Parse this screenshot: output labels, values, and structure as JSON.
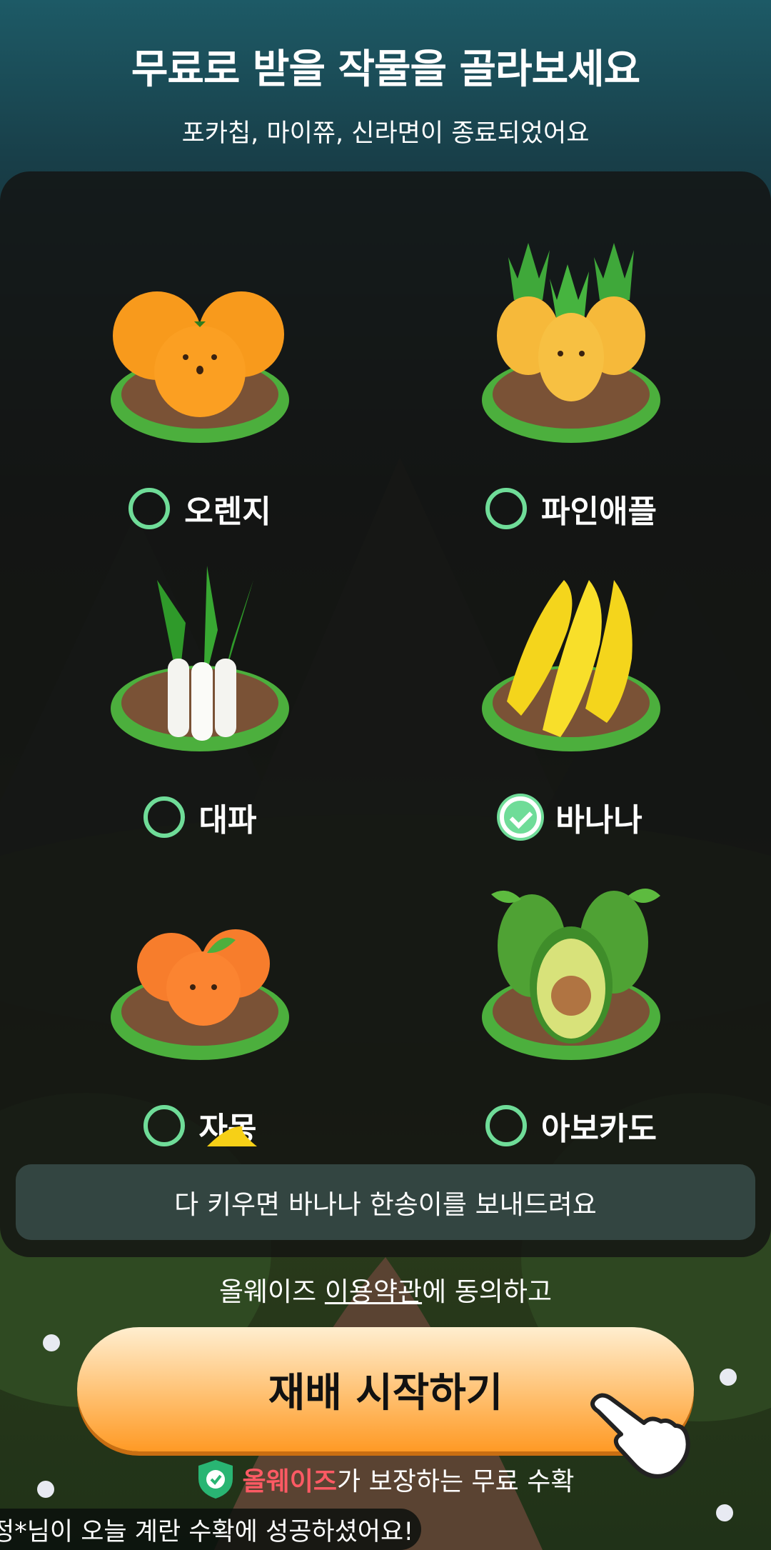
{
  "header": {
    "title": "무료로 받을 작물을 골라보세요",
    "subtitle": "포카칩, 마이쮸, 신라면이 종료되었어요"
  },
  "crops": [
    {
      "name": "오렌지",
      "icon": "orange-icon",
      "selected": false
    },
    {
      "name": "파인애플",
      "icon": "pineapple-icon",
      "selected": false
    },
    {
      "name": "대파",
      "icon": "green-onion-icon",
      "selected": false
    },
    {
      "name": "바나나",
      "icon": "banana-icon",
      "selected": true
    },
    {
      "name": "자몽",
      "icon": "grapefruit-icon",
      "selected": false
    },
    {
      "name": "아보카도",
      "icon": "avocado-icon",
      "selected": false
    }
  ],
  "notice": "다 키우면 바나나 한송이를 보내드려요",
  "terms": {
    "prefix": "올웨이즈 ",
    "link": "이용약관",
    "suffix": "에 동의하고"
  },
  "cta_label": "재배 시작하기",
  "guarantee": {
    "brand": "올웨이즈",
    "text": "가 보장하는 무료 수확"
  },
  "toast": "정*님이 오늘 계란 수확에 성공하셨어요!",
  "colors": {
    "accent_green": "#6fdc98",
    "cta_orange": "#ff9a25",
    "brand_red": "#ff5a64"
  }
}
